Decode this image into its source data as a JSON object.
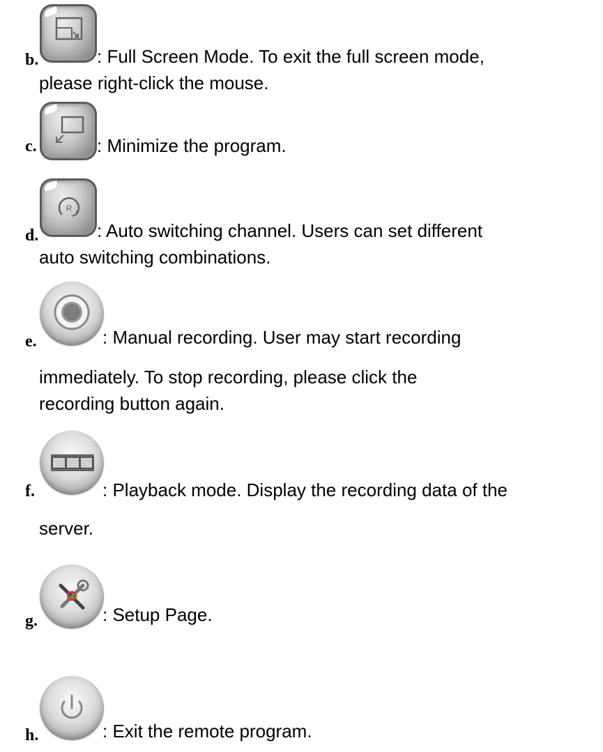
{
  "items": [
    {
      "marker": "b.",
      "icon": "full-screen-icon",
      "lines": [
        ": Full Screen Mode. To exit the full screen mode,",
        "please right-click the mouse."
      ]
    },
    {
      "marker": "c.",
      "icon": "minimize-icon",
      "lines": [
        ": Minimize the program."
      ]
    },
    {
      "marker": "d.",
      "icon": "auto-switch-icon",
      "lines": [
        ": Auto switching channel. Users can set different",
        "auto switching combinations."
      ]
    },
    {
      "marker": "e.",
      "icon": "record-icon",
      "lines": [
        ": Manual recording. User may start recording",
        "immediately. To stop recording, please click the",
        "recording button again."
      ]
    },
    {
      "marker": "f.",
      "icon": "playback-icon",
      "lines": [
        ": Playback mode. Display the recording data of the",
        "server."
      ]
    },
    {
      "marker": "g.",
      "icon": "setup-icon",
      "lines": [
        ": Setup Page."
      ]
    },
    {
      "marker": "h.",
      "icon": "power-icon",
      "lines": [
        ": Exit the remote program."
      ]
    }
  ]
}
